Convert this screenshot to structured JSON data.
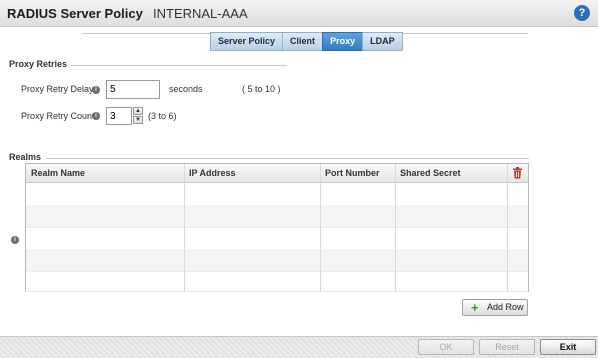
{
  "header": {
    "title": "RADIUS Server Policy",
    "subtitle": "INTERNAL-AAA",
    "help_icon": "?"
  },
  "tabs": [
    {
      "label": "Server Policy",
      "active": false
    },
    {
      "label": "Client",
      "active": false
    },
    {
      "label": "Proxy",
      "active": true
    },
    {
      "label": "LDAP",
      "active": false
    }
  ],
  "proxy_retries": {
    "section_label": "Proxy Retries",
    "retry_delay": {
      "label": "Proxy Retry Delay",
      "value": "5",
      "unit": "seconds",
      "range": "( 5 to 10 )"
    },
    "retry_count": {
      "label": "Proxy Retry Count",
      "value": "3",
      "range": "(3 to 6)"
    }
  },
  "realms": {
    "section_label": "Realms",
    "columns": [
      "Realm Name",
      "IP Address",
      "Port Number",
      "Shared Secret"
    ],
    "rows": [],
    "add_row_label": "Add Row"
  },
  "info_glyph": "i",
  "footer": {
    "ok_label": "OK",
    "reset_label": "Reset",
    "exit_label": "Exit"
  },
  "colors": {
    "tab_active": "#2f7cc4",
    "help_icon": "#2f6fb6",
    "delete_icon": "#c0392b",
    "add_icon": "#2c9a2c"
  }
}
